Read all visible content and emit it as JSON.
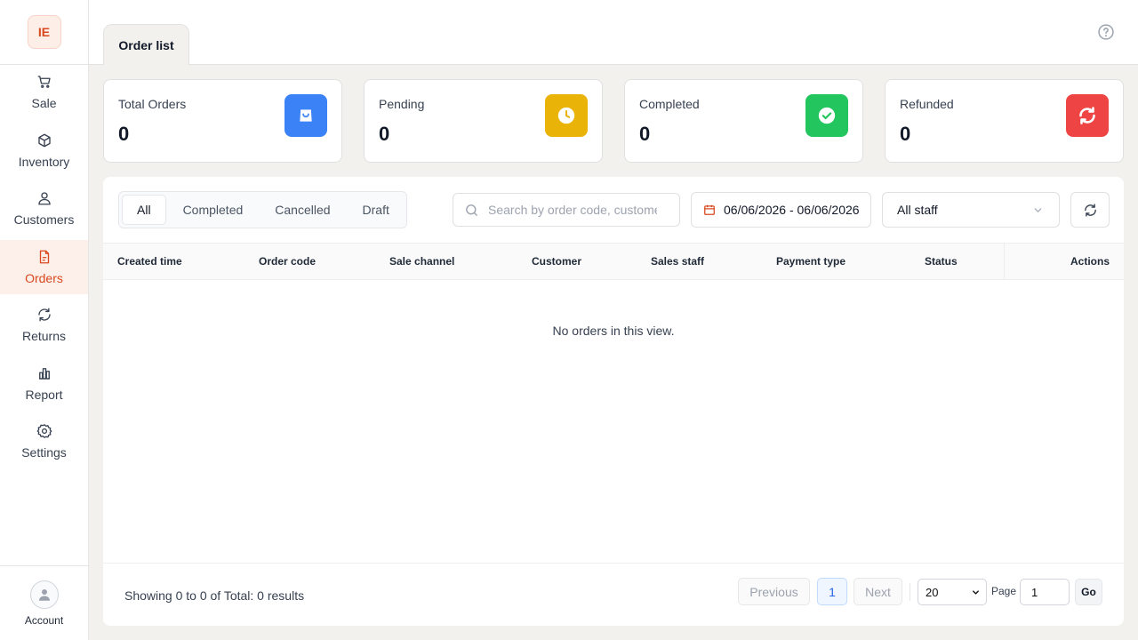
{
  "app": {
    "logo_text": "IE"
  },
  "sidebar": {
    "items": [
      {
        "label": "Sale",
        "icon": "cart-icon"
      },
      {
        "label": "Inventory",
        "icon": "box-icon"
      },
      {
        "label": "Customers",
        "icon": "user-icon"
      },
      {
        "label": "Orders",
        "icon": "document-icon",
        "active": true
      },
      {
        "label": "Returns",
        "icon": "refresh-icon"
      },
      {
        "label": "Report",
        "icon": "bar-chart-icon"
      },
      {
        "label": "Settings",
        "icon": "gear-icon"
      }
    ],
    "account_label": "Account"
  },
  "header": {
    "tab_label": "Order list",
    "help_icon": "help-circle-icon"
  },
  "stats": [
    {
      "label": "Total Orders",
      "value": "0",
      "icon": "bag-icon",
      "color": "#3b82f6"
    },
    {
      "label": "Pending",
      "value": "0",
      "icon": "clock-icon",
      "color": "#eab308"
    },
    {
      "label": "Completed",
      "value": "0",
      "icon": "check-circle-icon",
      "color": "#22c55e"
    },
    {
      "label": "Refunded",
      "value": "0",
      "icon": "refresh-icon",
      "color": "#ef4444"
    }
  ],
  "filters": {
    "tabs": [
      "All",
      "Completed",
      "Cancelled",
      "Draft"
    ],
    "active_tab": "All",
    "search_placeholder": "Search by order code, customer",
    "date_range": "06/06/2026 - 06/06/2026",
    "staff_select": "All staff"
  },
  "table": {
    "columns": [
      "Created time",
      "Order code",
      "Sale channel",
      "Customer",
      "Sales staff",
      "Payment type",
      "Status"
    ],
    "actions_column": "Actions",
    "empty_text": "No orders in this view."
  },
  "pagination": {
    "summary": "Showing 0 to 0 of Total: 0 results",
    "previous": "Previous",
    "current_page": "1",
    "next": "Next",
    "page_size": "20",
    "page_label": "Page",
    "page_input": "1",
    "go": "Go"
  },
  "colors": {
    "accent": "#d9481e",
    "primary": "#2563eb"
  }
}
